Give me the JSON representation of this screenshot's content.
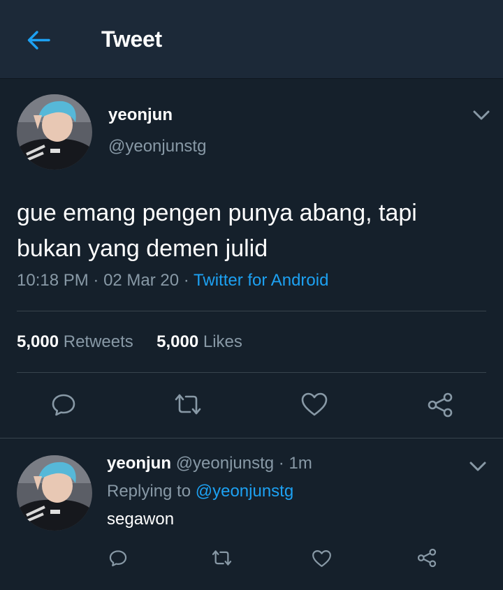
{
  "header": {
    "title": "Tweet",
    "back_icon": "arrow-left-icon",
    "accent": "#1da1f2"
  },
  "tweet": {
    "author_name": "yeonjun",
    "author_handle": "@yeonjunstg",
    "text_line1": "gue emang pengen punya abang, tapi",
    "text_line2": "bukan yang demen julid",
    "time": "10:18 PM",
    "sep1": " · ",
    "date": "02 Mar 20",
    "sep2": " · ",
    "source": "Twitter for Android",
    "retweets_count": "5,000",
    "retweets_label": "Retweets",
    "likes_count": "5,000",
    "likes_label": "Likes",
    "actions": [
      "reply-icon",
      "retweet-icon",
      "like-icon",
      "share-icon"
    ]
  },
  "reply": {
    "author_name": "yeonjun",
    "author_handle": "@yeonjunstg",
    "time_sep": " · ",
    "time": "1m",
    "replying_prefix": "Replying to ",
    "replying_handle": "@yeonjunstg",
    "text": "segawon",
    "actions": [
      "reply-icon",
      "retweet-icon",
      "like-icon",
      "share-icon"
    ]
  },
  "colors": {
    "background": "#15202b",
    "header": "#1c2938",
    "muted": "#8899a6",
    "link": "#1da1f2"
  }
}
